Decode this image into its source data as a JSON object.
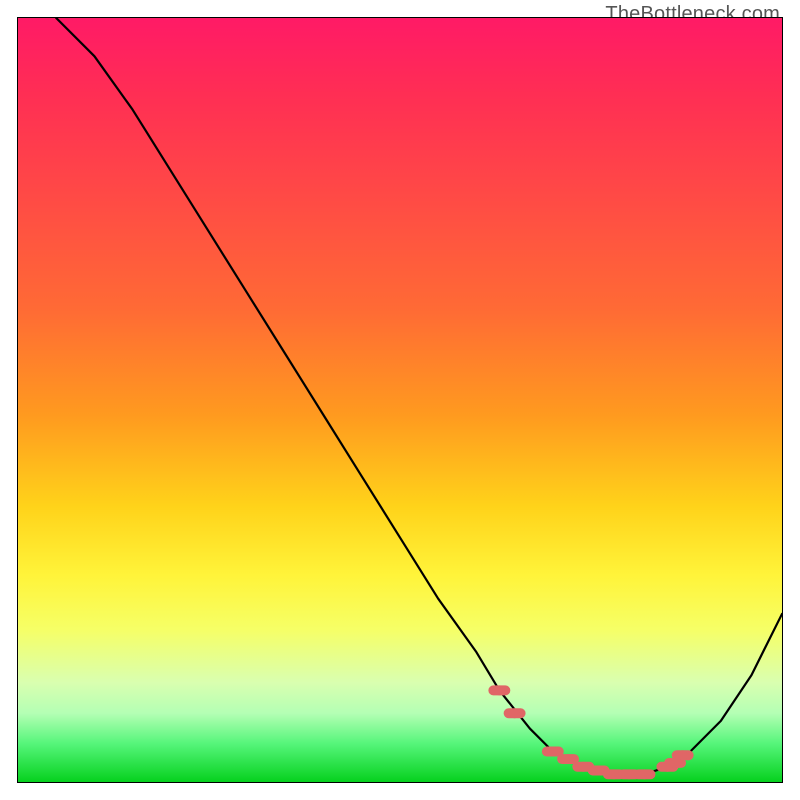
{
  "attribution": "TheBottleneck.com",
  "chart_data": {
    "type": "line",
    "title": "",
    "xlabel": "",
    "ylabel": "",
    "xlim": [
      0,
      100
    ],
    "ylim": [
      0,
      100
    ],
    "curve": {
      "x": [
        5,
        10,
        15,
        20,
        25,
        30,
        35,
        40,
        45,
        50,
        55,
        60,
        63,
        67,
        70,
        74,
        78,
        82,
        85,
        88,
        92,
        96,
        100
      ],
      "y": [
        100,
        95,
        88,
        80,
        72,
        64,
        56,
        48,
        40,
        32,
        24,
        17,
        12,
        7,
        4,
        2,
        1,
        1,
        2,
        4,
        8,
        14,
        22
      ]
    },
    "markers": {
      "x": [
        63,
        65,
        70,
        72,
        74,
        76,
        78,
        80,
        82,
        85,
        86,
        87
      ],
      "y": [
        12,
        9,
        4,
        3,
        2,
        1.5,
        1,
        1,
        1,
        2,
        2.5,
        3.5
      ]
    },
    "gradient_colors_top_to_bottom": [
      "#ff1a66",
      "#ff4747",
      "#ff9a1f",
      "#fff43a",
      "#d9ffb0",
      "#06d11e"
    ]
  }
}
